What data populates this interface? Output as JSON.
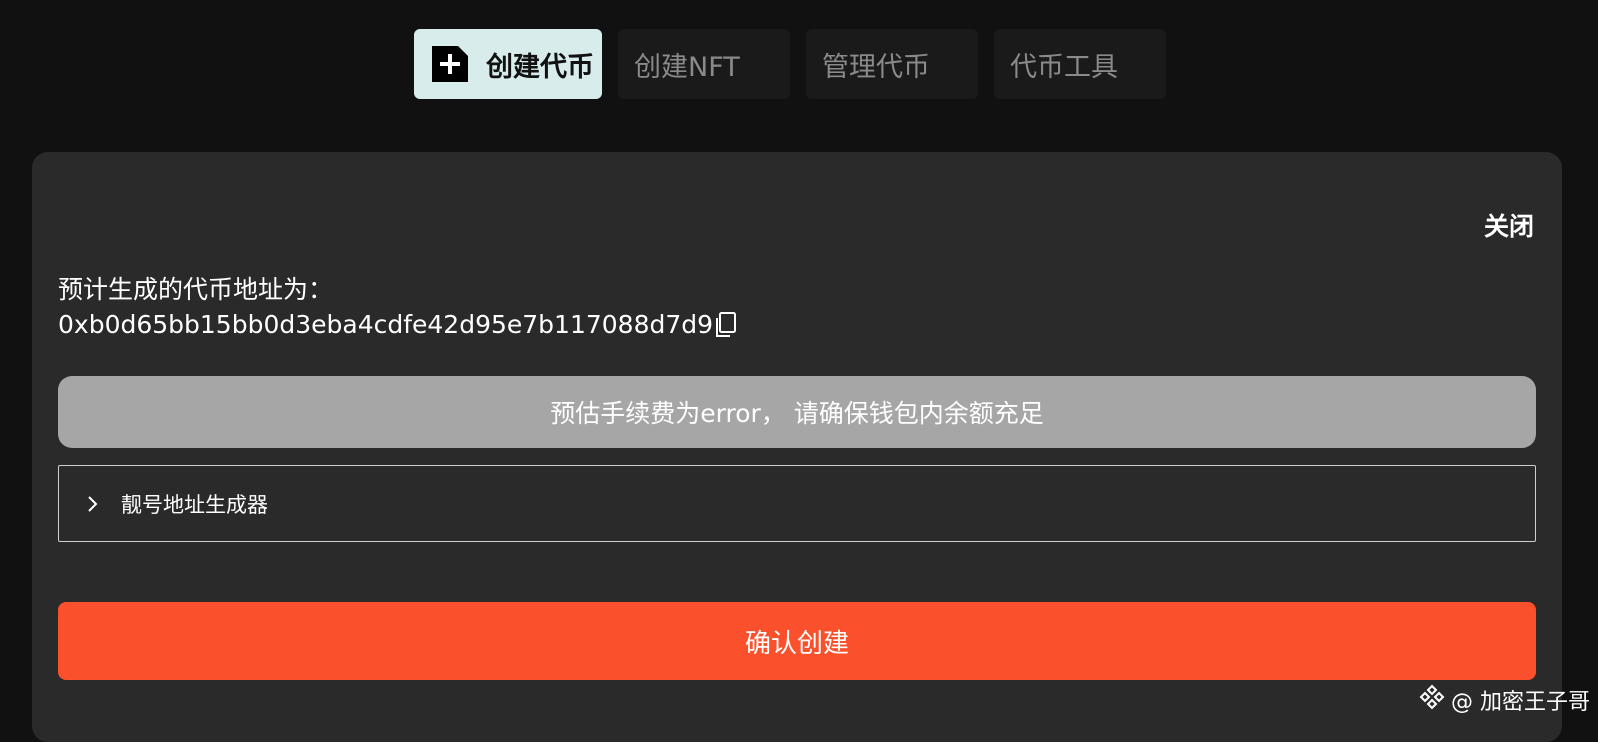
{
  "tabs": [
    {
      "label": "创建代币",
      "icon": "add-file-icon",
      "active": true
    },
    {
      "label": "创建NFT",
      "active": false
    },
    {
      "label": "管理代币",
      "active": false
    },
    {
      "label": "代币工具",
      "active": false
    }
  ],
  "panel": {
    "close_label": "关闭",
    "address_label": "预计生成的代币地址为：",
    "address_value": "0xb0d65bb15bb0d3eba4cdfe42d95e7b117088d7d9",
    "fee_notice": "预估手续费为error， 请确保钱包内余额充足",
    "vanity_label": "靓号地址生成器",
    "confirm_label": "确认创建"
  },
  "watermark": {
    "text": "@ 加密王子哥",
    "icon": "binance-logo-icon"
  },
  "colors": {
    "background": "#111111",
    "panel": "#2a2a2a",
    "active_tab": "#d8ecec",
    "fee_box": "#a6a6a6",
    "confirm": "#fa502c"
  }
}
